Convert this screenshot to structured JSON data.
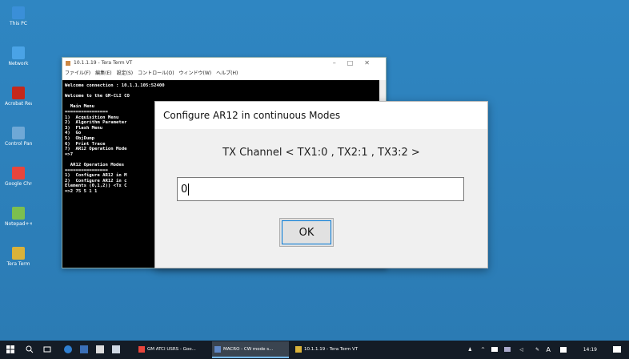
{
  "desktop": {
    "icons": [
      {
        "label": "This PC",
        "color": "#3a8fd8"
      },
      {
        "label": "Network",
        "color": "#4aa3e6"
      },
      {
        "label": "Acrobat Reader DC",
        "color": "#c4281c"
      },
      {
        "label": "Control Panel",
        "color": "#6fa8d6"
      },
      {
        "label": "Google Chrome",
        "color": "#e8453c"
      },
      {
        "label": "Notepad++ Shortcut",
        "color": "#7cbf4f"
      },
      {
        "label": "Tera Term",
        "color": "#d9b23a"
      }
    ]
  },
  "terminal": {
    "title": "10.1.1.19 - Tera Term VT",
    "menu": [
      "ファイル(F)",
      "編集(E)",
      "設定(S)",
      "コントロール(O)",
      "ウィンドウ(W)",
      "ヘルプ(H)"
    ],
    "lines": [
      "Welcome connection : 10.1.1.105:52400",
      "",
      "Welcome to the GM-CLI CO",
      "",
      "  Main Menu",
      "================",
      "1)  Acquisition Menu",
      "2)  Algorithm Parameter",
      "3)  Flash Menu",
      "4)  Go",
      "5)  ObjDump",
      "6)  Print Trace",
      "7)  AR12 Operation Mode",
      "=>7",
      "",
      "  AR12 Operation Modes",
      "================",
      "1)  Configure AR12 in M",
      "2)  Configure AR12 in c",
      "Elements (0,1,2)) <Tx C",
      "=>2 75 5 1 1"
    ]
  },
  "dialog": {
    "title": "Configure AR12 in continuous Modes",
    "prompt": "TX Channel < TX1:0 , TX2:1 , TX3:2 >",
    "input_value": "0",
    "ok_label": "OK"
  },
  "taskbar": {
    "tasks": [
      {
        "label": "GM ATCI USRS - Goo...",
        "icon_color": "#e8453c"
      },
      {
        "label": "MACRO - CW mode s...",
        "icon_color": "#5f87c6"
      },
      {
        "label": "10.1.1.19 - Tera Term VT",
        "icon_color": "#d9b23a"
      }
    ],
    "tray_ime": "A",
    "clock": "14:19"
  }
}
